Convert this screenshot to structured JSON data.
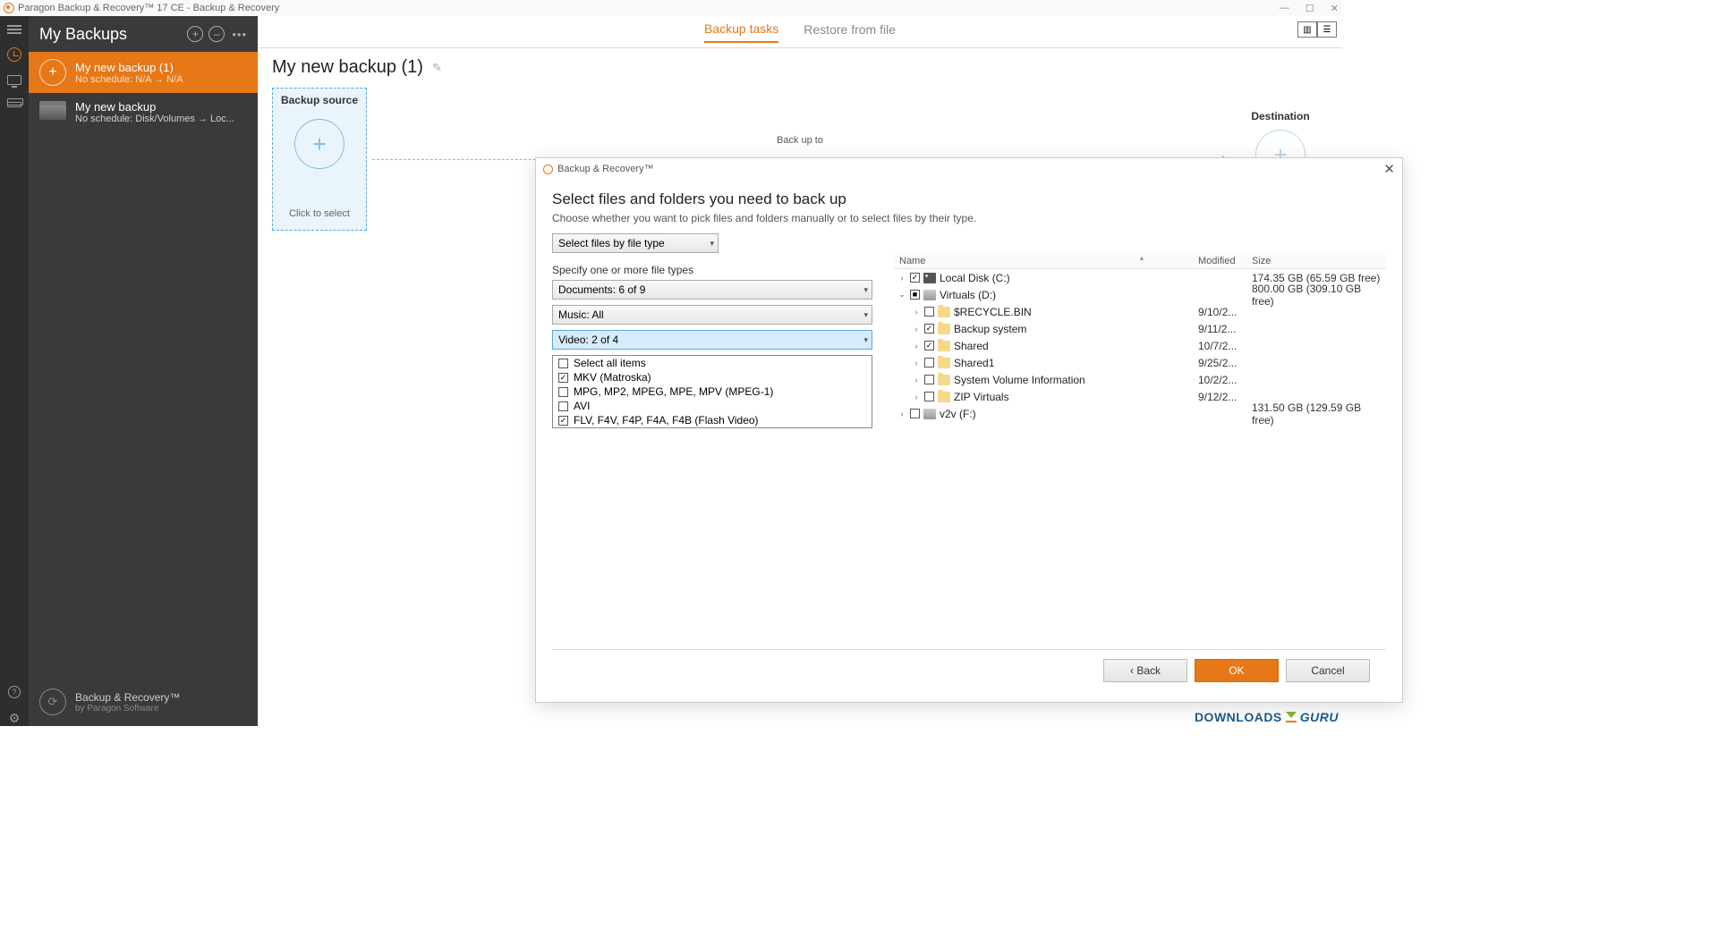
{
  "titlebar": {
    "title": "Paragon Backup & Recovery™ 17 CE - Backup & Recovery"
  },
  "sidebar": {
    "title": "My Backups",
    "items": [
      {
        "name": "My new backup (1)",
        "sub": "No schedule: N/A → N/A"
      },
      {
        "name": "My new backup",
        "sub": "No schedule: Disk/Volumes → Loc..."
      }
    ],
    "footer": {
      "product": "Backup & Recovery™",
      "by": "by Paragon Software"
    }
  },
  "tabs": {
    "backup": "Backup tasks",
    "restore": "Restore from file"
  },
  "page": {
    "title": "My new backup (1)",
    "source_label": "Backup source",
    "click_select": "Click to select",
    "backup_to": "Back up to",
    "dest_label": "Destination"
  },
  "dialog": {
    "title": "Backup & Recovery™",
    "heading": "Select files and folders you need to back up",
    "desc": "Choose whether you want to pick files and folders manually or to select files by their type.",
    "mode": "Select files by file type",
    "spec_label": "Specify one or more file types",
    "filetype_selects": [
      "Documents: 6 of 9",
      "Music: All",
      "Video: 2 of 4"
    ],
    "video_options": [
      {
        "label": "Select all items",
        "checked": false
      },
      {
        "label": "MKV (Matroska)",
        "checked": true
      },
      {
        "label": "MPG, MP2, MPEG, MPE, MPV (MPEG-1)",
        "checked": false
      },
      {
        "label": "AVI",
        "checked": false
      },
      {
        "label": "FLV, F4V, F4P, F4A, F4B (Flash Video)",
        "checked": true
      }
    ],
    "tree_headers": {
      "name": "Name",
      "modified": "Modified",
      "size": "Size"
    },
    "tree": [
      {
        "exp": "›",
        "chk": true,
        "icon": "hdd",
        "name": "Local Disk (C:)",
        "mod": "",
        "size": "174.35 GB (65.59 GB free)",
        "ind": 0
      },
      {
        "exp": "⌄",
        "chk": "mixed",
        "icon": "disk",
        "name": "Virtuals (D:)",
        "mod": "",
        "size": "800.00 GB (309.10 GB free)",
        "ind": 0
      },
      {
        "exp": "›",
        "chk": false,
        "icon": "folder",
        "name": "$RECYCLE.BIN",
        "mod": "9/10/2...",
        "size": "",
        "ind": 1
      },
      {
        "exp": "›",
        "chk": true,
        "icon": "folder",
        "name": "Backup system",
        "mod": "9/11/2...",
        "size": "",
        "ind": 1
      },
      {
        "exp": "›",
        "chk": true,
        "icon": "folder",
        "name": "Shared",
        "mod": "10/7/2...",
        "size": "",
        "ind": 1
      },
      {
        "exp": "›",
        "chk": false,
        "icon": "folder",
        "name": "Shared1",
        "mod": "9/25/2...",
        "size": "",
        "ind": 1
      },
      {
        "exp": "›",
        "chk": false,
        "icon": "folder",
        "name": "System Volume Information",
        "mod": "10/2/2...",
        "size": "",
        "ind": 1
      },
      {
        "exp": "›",
        "chk": false,
        "icon": "folder",
        "name": "ZIP Virtuals",
        "mod": "9/12/2...",
        "size": "",
        "ind": 1
      },
      {
        "exp": "›",
        "chk": false,
        "icon": "disk",
        "name": "v2v (F:)",
        "mod": "",
        "size": "131.50 GB (129.59 GB free)",
        "ind": 0
      }
    ],
    "buttons": {
      "back": "‹ Back",
      "ok": "OK",
      "cancel": "Cancel"
    }
  },
  "watermark": {
    "a": "DOWNLOADS",
    "b": "GURU"
  }
}
